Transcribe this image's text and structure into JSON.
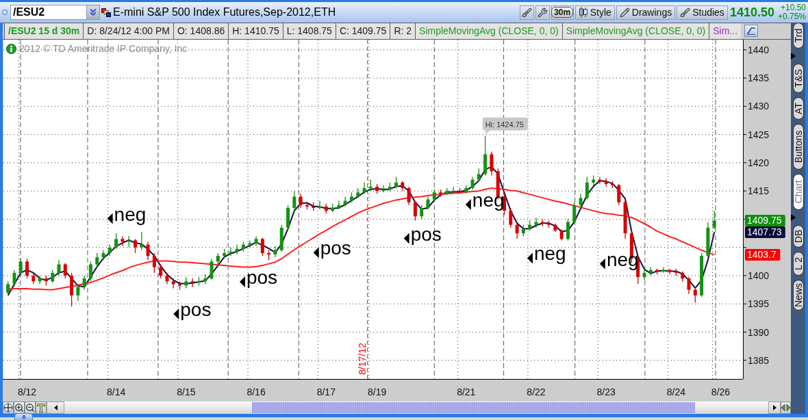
{
  "window": {
    "title": "E-mini S&P 500 Index Futures,Sep-2012,ETH"
  },
  "symbol_field": {
    "value": "/ESU2"
  },
  "toolbar": {
    "buttons": [
      {
        "label": "30m",
        "kind": "pill"
      },
      {
        "label": "Style",
        "kind": "labeled"
      },
      {
        "label": "Drawings",
        "kind": "labeled"
      },
      {
        "label": "Studies",
        "kind": "labeled"
      }
    ]
  },
  "quote": {
    "last": "1410.50",
    "change": "+10.50",
    "change_percent": "+0.75%"
  },
  "info_bar": [
    {
      "text": "/ESU2 15 d 30m",
      "kind": "symbol",
      "color": "#1f9b1f"
    },
    {
      "text": "D: 8/24/12 4:00 PM",
      "kind": "value",
      "color": "#1a1a1a"
    },
    {
      "text": "O: 1408.86",
      "kind": "value",
      "color": "#1a1a1a"
    },
    {
      "text": "H: 1410.75",
      "kind": "value",
      "color": "#1a1a1a"
    },
    {
      "text": "L: 1408.75",
      "kind": "value",
      "color": "#1a1a1a"
    },
    {
      "text": "C: 1409.75",
      "kind": "value",
      "color": "#1a1a1a"
    },
    {
      "text": "R: 2",
      "kind": "value",
      "color": "#1a1a1a"
    },
    {
      "text": "SimpleMovingAvg (CLOSE, 0, 0)",
      "kind": "study",
      "color": "#1f9b1f"
    },
    {
      "text": "SimpleMovingAvg (CLOSE, 0, 0)",
      "kind": "study",
      "color": "#1f9b1f"
    },
    {
      "text": "Sim...",
      "kind": "study",
      "color": "#9a2fc8"
    }
  ],
  "copyright": "2012 © TD Ameritrade IP Company, Inc",
  "chart": {
    "chart_data": [
      {
        "type": "candlestick",
        "grid": true,
        "categories": [
          null,
          null,
          null,
          "8/12",
          null,
          null,
          null,
          null,
          null,
          null,
          null,
          null,
          null,
          null,
          null,
          null,
          null,
          "8/14",
          null,
          null,
          null,
          null,
          null,
          null,
          null,
          null,
          null,
          null,
          "8/15",
          null,
          null,
          null,
          null,
          null,
          null,
          null,
          null,
          null,
          null,
          "8/16",
          null,
          null,
          null,
          null,
          null,
          null,
          null,
          null,
          null,
          null,
          "8/17",
          null,
          null,
          null,
          null,
          null,
          null,
          null,
          "8/19",
          null,
          null,
          null,
          null,
          null,
          null,
          null,
          null,
          null,
          null,
          null,
          null,
          null,
          "8/21",
          null,
          null,
          null,
          null,
          null,
          null,
          null,
          null,
          null,
          null,
          "8/22",
          null,
          null,
          null,
          null,
          null,
          null,
          null,
          null,
          null,
          null,
          "8/23",
          null,
          null,
          null,
          null,
          null,
          null,
          null,
          null,
          null,
          null,
          "8/24",
          null,
          null,
          null,
          null,
          null,
          null,
          "8/26",
          null,
          null,
          null
        ],
        "ohlc": [
          [
            1397,
            1399,
            1396.5,
            1398.5
          ],
          [
            1398.5,
            1401,
            1398,
            1400.5
          ],
          [
            1400.5,
            1403,
            1400,
            1402.5
          ],
          [
            1402.5,
            1403,
            1399.5,
            1400
          ],
          [
            1400,
            1400.5,
            1398.5,
            1399
          ],
          [
            1399,
            1400,
            1398.5,
            1399.5
          ],
          [
            1399.5,
            1400,
            1398.25,
            1399
          ],
          [
            1399,
            1401,
            1398.75,
            1400.5
          ],
          [
            1400.5,
            1402.75,
            1400,
            1402
          ],
          [
            1402,
            1402.25,
            1399.5,
            1400
          ],
          [
            1400,
            1400.5,
            1394.5,
            1396.5
          ],
          [
            1396.5,
            1398.5,
            1395.5,
            1398
          ],
          [
            1398,
            1400,
            1397.5,
            1399.5
          ],
          [
            1399.5,
            1402.5,
            1399,
            1402
          ],
          [
            1402,
            1404,
            1401.5,
            1403.25
          ],
          [
            1403.25,
            1404.5,
            1402.75,
            1404
          ],
          [
            1404,
            1405.5,
            1403.5,
            1405
          ],
          [
            1405,
            1407.5,
            1404.75,
            1406.5
          ],
          [
            1406.5,
            1407,
            1405.25,
            1406
          ],
          [
            1406,
            1407,
            1405,
            1406.25
          ],
          [
            1406.25,
            1406.5,
            1404,
            1405
          ],
          [
            1405,
            1407.75,
            1404.5,
            1405.5
          ],
          [
            1405.5,
            1406,
            1402.75,
            1403.5
          ],
          [
            1403.5,
            1404,
            1400.5,
            1401.5
          ],
          [
            1401.5,
            1402,
            1399.5,
            1400
          ],
          [
            1400,
            1400.5,
            1398.5,
            1399
          ],
          [
            1399,
            1399.5,
            1397.75,
            1398.5
          ],
          [
            1398.5,
            1399,
            1397.5,
            1398.25
          ],
          [
            1398.25,
            1399.75,
            1397.75,
            1399
          ],
          [
            1399,
            1399.5,
            1398,
            1398.75
          ],
          [
            1398.75,
            1399.75,
            1398.25,
            1399
          ],
          [
            1399,
            1400.25,
            1398.5,
            1399.5
          ],
          [
            1399.5,
            1403,
            1399.25,
            1402.5
          ],
          [
            1402.5,
            1404,
            1402,
            1403.5
          ],
          [
            1403.5,
            1404.75,
            1403,
            1404
          ],
          [
            1404,
            1405,
            1403.5,
            1404.25
          ],
          [
            1404.25,
            1405.5,
            1403.75,
            1404.75
          ],
          [
            1404.75,
            1406,
            1404.25,
            1405.5
          ],
          [
            1405.5,
            1406.25,
            1405,
            1405.75
          ],
          [
            1405.75,
            1407,
            1405.25,
            1406.5
          ],
          [
            1406.5,
            1406.75,
            1403.5,
            1404
          ],
          [
            1404,
            1404.5,
            1402.75,
            1403.75
          ],
          [
            1403.75,
            1405.25,
            1403.25,
            1404.5
          ],
          [
            1404.5,
            1409,
            1404.25,
            1408.5
          ],
          [
            1408.5,
            1412.5,
            1408,
            1412
          ],
          [
            1412,
            1415,
            1411.5,
            1414
          ],
          [
            1414,
            1414.5,
            1412,
            1412.5
          ],
          [
            1412.5,
            1413,
            1411.75,
            1412.25
          ],
          [
            1412.25,
            1413,
            1411.5,
            1412
          ],
          [
            1412,
            1413.25,
            1411.75,
            1412.25
          ],
          [
            1412.25,
            1412.75,
            1411,
            1411.5
          ],
          [
            1411.5,
            1412.75,
            1411.25,
            1412
          ],
          [
            1412,
            1413.25,
            1411.75,
            1412.5
          ],
          [
            1412.5,
            1414,
            1412.25,
            1413.25
          ],
          [
            1413.25,
            1414.75,
            1413,
            1414
          ],
          [
            1414,
            1415.5,
            1413.75,
            1414.75
          ],
          [
            1414.75,
            1416.5,
            1414.5,
            1415.5
          ],
          [
            1415.5,
            1417,
            1415,
            1415.75
          ],
          [
            1415.75,
            1416.25,
            1414.5,
            1415
          ],
          [
            1415,
            1416,
            1414.75,
            1415.25
          ],
          [
            1415.25,
            1416.5,
            1415,
            1415.75
          ],
          [
            1415.75,
            1417.5,
            1415.5,
            1416.5
          ],
          [
            1416.5,
            1416.75,
            1415,
            1415.5
          ],
          [
            1415.5,
            1415.75,
            1412.5,
            1413
          ],
          [
            1413,
            1413.25,
            1409.75,
            1410.5
          ],
          [
            1410.5,
            1412.5,
            1410,
            1412
          ],
          [
            1412,
            1414,
            1411.75,
            1413.5
          ],
          [
            1413.5,
            1415.25,
            1413.25,
            1414.75
          ],
          [
            1414.75,
            1415.25,
            1414,
            1414.5
          ],
          [
            1414.5,
            1415.5,
            1414.25,
            1415
          ],
          [
            1415,
            1415.75,
            1414.5,
            1415
          ],
          [
            1415,
            1415.5,
            1414.5,
            1414.75
          ],
          [
            1414.75,
            1416,
            1414.5,
            1415.5
          ],
          [
            1415.5,
            1417.5,
            1415.25,
            1417
          ],
          [
            1417,
            1419,
            1416.75,
            1418
          ],
          [
            1418,
            1424.75,
            1417.75,
            1421.5
          ],
          [
            1421.5,
            1422,
            1417.75,
            1418.5
          ],
          [
            1418.5,
            1419,
            1413.5,
            1414
          ],
          [
            1414,
            1414.5,
            1410.75,
            1411.5
          ],
          [
            1411.5,
            1412,
            1408.5,
            1409
          ],
          [
            1409,
            1409.5,
            1406.5,
            1407.5
          ],
          [
            1407.5,
            1409,
            1407,
            1408.25
          ],
          [
            1408.25,
            1409.75,
            1408,
            1409
          ],
          [
            1409,
            1410.25,
            1408.5,
            1409.5
          ],
          [
            1409.5,
            1410,
            1408.75,
            1409.25
          ],
          [
            1409.25,
            1409.75,
            1408.5,
            1409
          ],
          [
            1409,
            1409.25,
            1407.75,
            1408
          ],
          [
            1408,
            1408.25,
            1406.25,
            1406.5
          ],
          [
            1406.5,
            1410,
            1406.25,
            1409.5
          ],
          [
            1409.5,
            1413,
            1409.25,
            1412.5
          ],
          [
            1412.5,
            1414.5,
            1412,
            1413.75
          ],
          [
            1413.75,
            1417.5,
            1413.5,
            1416.5
          ],
          [
            1416.5,
            1417.75,
            1416,
            1417
          ],
          [
            1417,
            1417.5,
            1416.25,
            1416.75
          ],
          [
            1416.75,
            1417.25,
            1415.75,
            1416.25
          ],
          [
            1416.25,
            1416.75,
            1415.5,
            1416
          ],
          [
            1416,
            1416.25,
            1412.5,
            1413
          ],
          [
            1413,
            1413.5,
            1406.5,
            1407.5
          ],
          [
            1407.5,
            1408,
            1402.25,
            1403
          ],
          [
            1403,
            1403.5,
            1398.5,
            1399.75
          ],
          [
            1399.75,
            1401.5,
            1399.25,
            1400.5
          ],
          [
            1400.5,
            1401.5,
            1400,
            1401
          ],
          [
            1401,
            1401.25,
            1400.25,
            1400.75
          ],
          [
            1400.75,
            1401.5,
            1400.5,
            1401
          ],
          [
            1401,
            1401.25,
            1400.25,
            1400.75
          ],
          [
            1400.75,
            1401.25,
            1400,
            1400.5
          ],
          [
            1400.5,
            1400.75,
            1399,
            1399.5
          ],
          [
            1399.5,
            1399.75,
            1396.75,
            1397.5
          ],
          [
            1397.5,
            1398,
            1395.25,
            1396.5
          ],
          [
            1396.5,
            1404,
            1396.25,
            1403.5
          ],
          [
            1403.5,
            1409.5,
            1403.25,
            1408.5
          ],
          [
            1408.5,
            1411.5,
            1408.25,
            1409.75
          ],
          null,
          null,
          null,
          null
        ],
        "series": [
          {
            "type": "line",
            "color": "#10103c",
            "values": [
              1396.5,
              1398.5,
              1400.5,
              1401,
              1400.5,
              1399.5,
              1399.2,
              1399.7,
              1400.5,
              1400.8,
              1399.5,
              1398.2,
              1398,
              1399.8,
              1401.6,
              1403.1,
              1404.1,
              1405.2,
              1405.8,
              1406.3,
              1405.8,
              1405.6,
              1404.7,
              1403.5,
              1401.7,
              1400.2,
              1399.2,
              1398.6,
              1398.6,
              1398.7,
              1398.9,
              1399.1,
              1400.3,
              1401.8,
              1403.3,
              1403.9,
              1404.3,
              1404.8,
              1405.3,
              1405.9,
              1405.4,
              1404.8,
              1404.1,
              1405.6,
              1408.3,
              1411.5,
              1412.8,
              1412.9,
              1412.3,
              1412.2,
              1411.9,
              1411.9,
              1412,
              1412.6,
              1413.3,
              1414,
              1414.8,
              1415.3,
              1415.4,
              1415.3,
              1415.3,
              1415.8,
              1415.9,
              1415,
              1413,
              1411.8,
              1412,
              1413.4,
              1414.3,
              1414.8,
              1414.8,
              1414.9,
              1415.1,
              1415.8,
              1416.8,
              1418.8,
              1419.3,
              1418,
              1414.7,
              1411.5,
              1409.3,
              1408.3,
              1408.3,
              1408.9,
              1409.3,
              1409.3,
              1408.8,
              1407.8,
              1408,
              1409.5,
              1411.9,
              1414.3,
              1415.8,
              1416.8,
              1416.7,
              1416.3,
              1415.1,
              1413.6,
              1407.8,
              1403.4,
              1401.1,
              1400.4,
              1400.8,
              1400.9,
              1400.8,
              1400.8,
              1400.3,
              1399.2,
              1397.8,
              1399.2,
              1402.8,
              1407.7,
              null,
              null,
              null,
              null
            ]
          },
          {
            "type": "line",
            "color": "#ff2020",
            "values": [
              1397.6,
              1397.7,
              1397.7,
              1397.7,
              1397.6,
              1397.6,
              1397.5,
              1397.5,
              1397.7,
              1397.9,
              1398.1,
              1398.3,
              1398.6,
              1398.8,
              1399.2,
              1399.6,
              1400.1,
              1400.5,
              1400.9,
              1401.4,
              1401.8,
              1402.1,
              1402.4,
              1402.6,
              1402.6,
              1402.6,
              1402.5,
              1402.4,
              1402.4,
              1402.3,
              1402.2,
              1402.1,
              1402,
              1401.9,
              1401.8,
              1401.7,
              1401.6,
              1401.5,
              1401.5,
              1401.6,
              1401.8,
              1402.1,
              1402.4,
              1403,
              1403.8,
              1404.6,
              1405.3,
              1406,
              1406.7,
              1407.4,
              1408,
              1408.7,
              1409.3,
              1409.9,
              1410.5,
              1411.1,
              1411.6,
              1412,
              1412.4,
              1412.8,
              1413.1,
              1413.4,
              1413.6,
              1413.8,
              1413.9,
              1414,
              1414.2,
              1414.3,
              1414.4,
              1414.5,
              1414.6,
              1414.7,
              1414.8,
              1414.9,
              1415,
              1415.3,
              1415.5,
              1415.4,
              1415.3,
              1415.1,
              1415,
              1414.7,
              1414.4,
              1414.1,
              1413.8,
              1413.5,
              1413.2,
              1413,
              1412.7,
              1412.4,
              1412.1,
              1411.8,
              1411.5,
              1411.2,
              1411,
              1410.9,
              1410.7,
              1410.6,
              1410.3,
              1409.8,
              1409.2,
              1408.6,
              1407.9,
              1407.4,
              1406.9,
              1406.5,
              1406,
              1405.5,
              1405,
              1404.5,
              1404.1,
              1403.7,
              null,
              null,
              null,
              null
            ]
          }
        ],
        "ylim": [
          1381.7,
          1441.8
        ],
        "yticks": [
          1385,
          1390,
          1395,
          1400,
          1415,
          1420,
          1425,
          1430,
          1435,
          1440
        ],
        "annotations": [
          "neg",
          "pos",
          "pos",
          "pos",
          "8/17/12",
          "pos",
          "neg",
          "Hi: 1424.75",
          "neg",
          "neg"
        ]
      }
    ],
    "price_tags": [
      {
        "label": "1409.75",
        "color": "#0f8f0f"
      },
      {
        "label": "1407.73",
        "color": "#0b0b3b"
      },
      {
        "label": "1403.7",
        "color": "#ff0000"
      }
    ]
  },
  "side_tabs": [
    {
      "label": "Trd",
      "selected": false
    },
    {
      "label": "T&S",
      "selected": false
    },
    {
      "label": "AT",
      "selected": false
    },
    {
      "label": "Buttons",
      "selected": false
    },
    {
      "label": "Chart",
      "selected": true
    },
    {
      "label": "DB",
      "selected": false
    },
    {
      "label": "L 2",
      "selected": false
    },
    {
      "label": "News",
      "selected": false
    }
  ]
}
